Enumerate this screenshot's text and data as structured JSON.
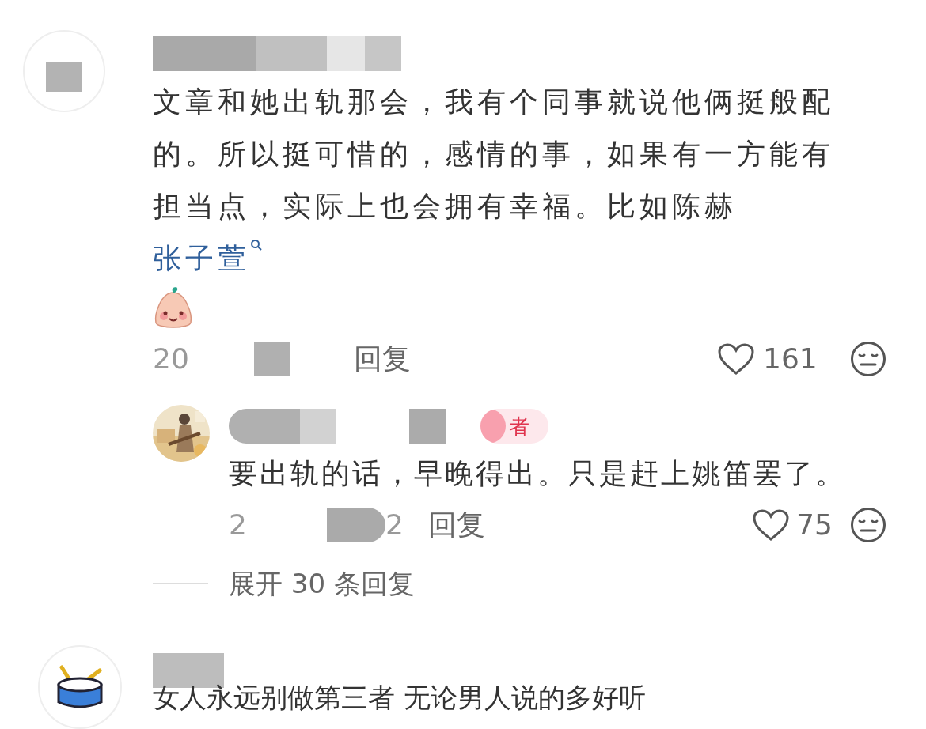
{
  "comments": [
    {
      "text": "文章和她出轨那会，我有个同事就说他俩挺般配的。所以挺可惜的，感情的事，如果有一方能有担当点，实际上也会拥有幸福。比如陈赫",
      "mention": "张子萱",
      "emoji": true,
      "date": "20",
      "reply_label": "回复",
      "likes": "161",
      "liked": false,
      "replies": [
        {
          "badge": "者",
          "text": "要出轨的话，早晚得出。只是赶上姚笛罢了。",
          "date": "2",
          "date_tail": "2",
          "reply_label": "回复",
          "likes": "75",
          "liked": false
        }
      ],
      "expand": "展开 30 条回复"
    },
    {
      "text": "女人永远别做第三者 无论男人说的多好听"
    }
  ]
}
